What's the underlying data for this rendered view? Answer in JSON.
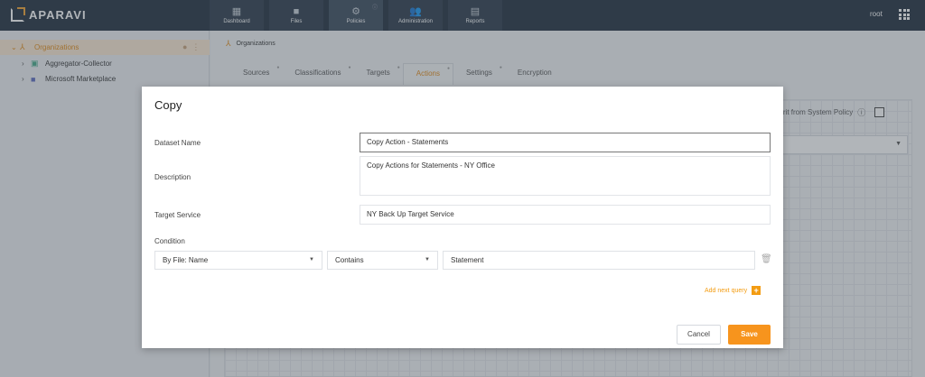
{
  "app": {
    "brand": "APARAVI",
    "user": "root"
  },
  "nav": [
    {
      "label": "Dashboard",
      "icon": "dashboard-icon"
    },
    {
      "label": "Files",
      "icon": "folder-icon"
    },
    {
      "label": "Policies",
      "icon": "gear-icon"
    },
    {
      "label": "Administration",
      "icon": "users-icon"
    },
    {
      "label": "Reports",
      "icon": "report-icon"
    }
  ],
  "sidebar": {
    "items": [
      {
        "label": "Organizations",
        "icon": "org-icon"
      },
      {
        "label": "Aggregator-Collector",
        "icon": "aggregator-icon"
      },
      {
        "label": "Microsoft Marketplace",
        "icon": "folder-icon"
      }
    ]
  },
  "breadcrumb": "Organizations",
  "tabs": [
    "Sources",
    "Classifications",
    "Targets",
    "Actions",
    "Settings",
    "Encryption"
  ],
  "background": {
    "inherit_label": "herit from System Policy"
  },
  "modal": {
    "title": "Copy",
    "dataset_name_label": "Dataset Name",
    "dataset_name_value": "Copy Action - Statements",
    "description_label": "Description",
    "description_value": "Copy Actions for Statements - NY Office",
    "target_service_label": "Target Service",
    "target_service_value": "NY Back Up Target Service",
    "condition_label": "Condition",
    "condition_field": "By File: Name",
    "condition_operator": "Contains",
    "condition_value": "Statement",
    "add_next_query": "Add next query",
    "cancel_label": "Cancel",
    "save_label": "Save"
  },
  "colors": {
    "accent": "#f7941d",
    "topbar": "#1f2d3d"
  }
}
